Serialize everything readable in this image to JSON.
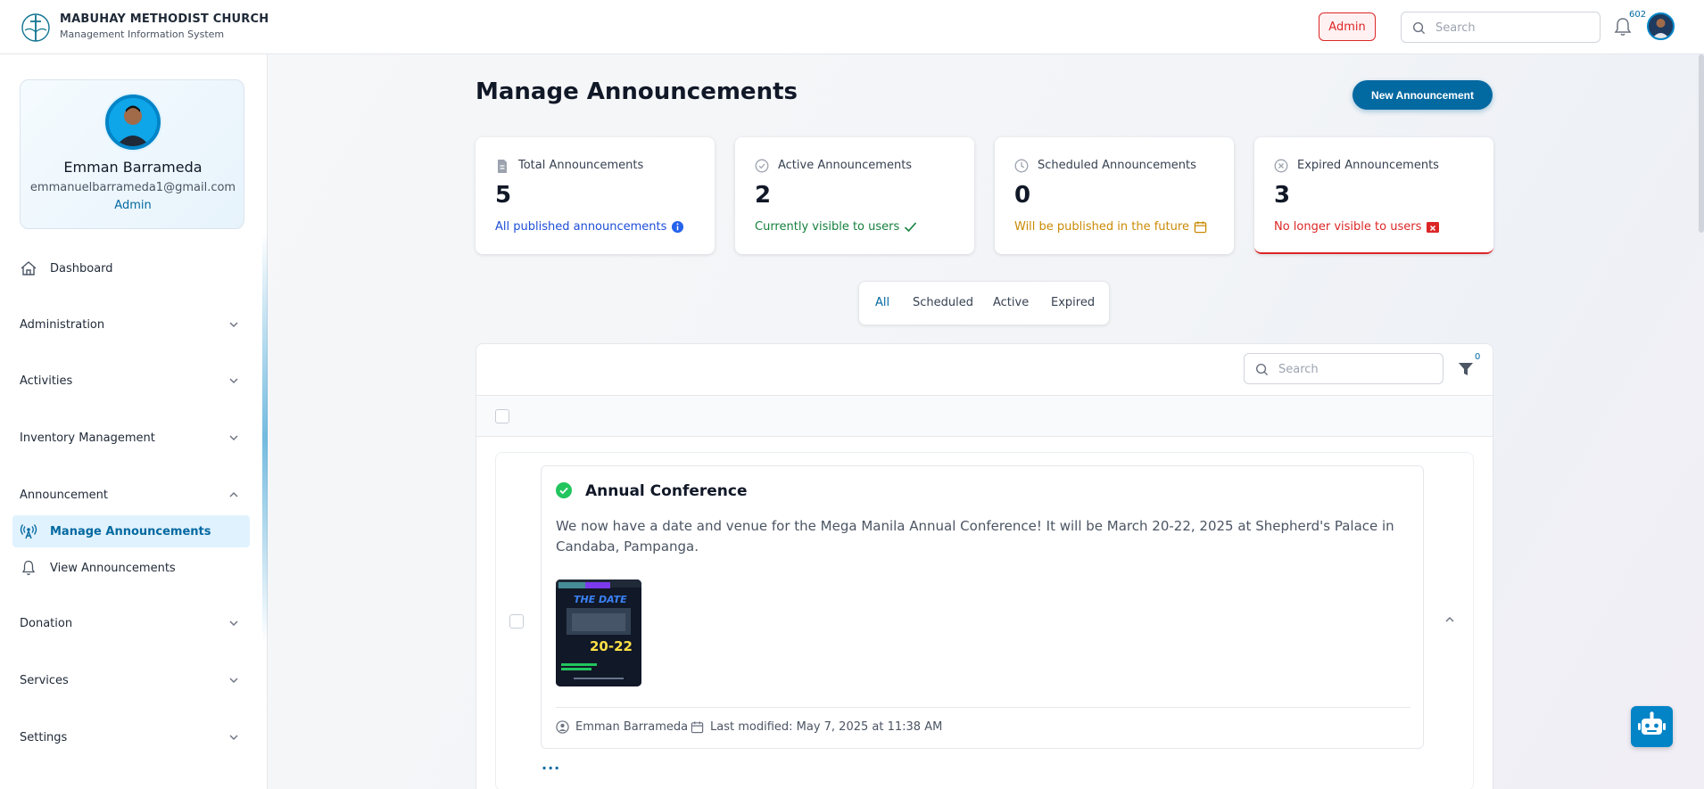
{
  "header": {
    "church_name": "MABUHAY METHODIST CHURCH",
    "subtitle": "Management Information System",
    "role_badge": "Admin",
    "search_placeholder": "Search",
    "notification_count": "602"
  },
  "sidebar": {
    "profile": {
      "name": "Emman Barrameda",
      "email": "emmanuelbarrameda1@gmail.com",
      "role": "Admin"
    },
    "items": [
      {
        "label": "Dashboard",
        "icon": "home-icon"
      },
      {
        "label": "Administration",
        "icon": "chevron-down-icon"
      },
      {
        "label": "Activities",
        "icon": "chevron-down-icon"
      },
      {
        "label": "Inventory Management",
        "icon": "chevron-down-icon"
      },
      {
        "label": "Announcement",
        "icon": "chevron-up-icon"
      },
      {
        "label": "Manage Announcements",
        "icon": "broadcast-icon"
      },
      {
        "label": "View Announcements",
        "icon": "bell-icon"
      },
      {
        "label": "Donation",
        "icon": "chevron-down-icon"
      },
      {
        "label": "Services",
        "icon": "chevron-down-icon"
      },
      {
        "label": "Settings",
        "icon": "chevron-down-icon"
      }
    ]
  },
  "main": {
    "title": "Manage Announcements",
    "new_button": "New Announcement",
    "stats": [
      {
        "label": "Total Announcements",
        "value": "5",
        "desc": "All published announcements",
        "color": "#1d4ed8"
      },
      {
        "label": "Active Announcements",
        "value": "2",
        "desc": "Currently visible to users",
        "color": "#15803d"
      },
      {
        "label": "Scheduled Announcements",
        "value": "0",
        "desc": "Will be published in the future",
        "color": "#ca8a04"
      },
      {
        "label": "Expired Announcements",
        "value": "3",
        "desc": "No longer visible to users",
        "color": "#dc2626"
      }
    ],
    "tabs": [
      "All",
      "Scheduled",
      "Active",
      "Expired"
    ],
    "list": {
      "search_placeholder": "Search",
      "filter_count": "0"
    },
    "announcement": {
      "title": "Annual Conference",
      "body": "We now have a date and venue for the Mega Manila Annual Conference! It will be March 20-22, 2025 at Shepherd's Palace in Candaba, Pampanga.",
      "author": "Emman Barrameda",
      "modified": "Last modified: May 7, 2025 at 11:38 AM",
      "more": "...",
      "poster": {
        "top_text": "THE DATE",
        "dates": "20-22"
      }
    }
  },
  "colors": {
    "accent": "#0369a1",
    "active_nav_bg": "#e0f2fe",
    "danger": "#dc2626",
    "success": "#22c55e"
  }
}
